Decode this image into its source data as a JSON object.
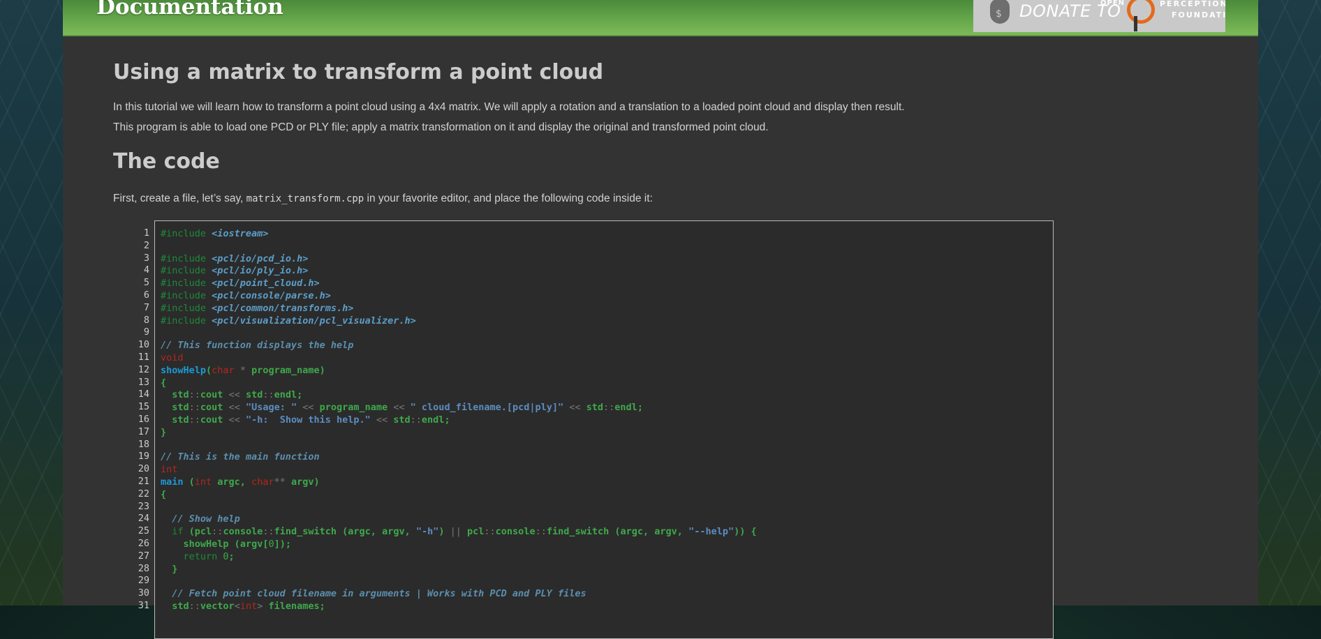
{
  "header": {
    "title": "Documentation",
    "donate": {
      "text": "DONATE TO",
      "open": "OPEN",
      "perception": "PERCEPTION",
      "foundation": "FOUNDATION"
    }
  },
  "article": {
    "title": "Using a matrix to transform a point cloud",
    "intro_1": "In this tutorial we will learn how to transform a point cloud using a 4x4 matrix. We will apply a rotation and a translation to a loaded point cloud and display then result.",
    "intro_2": "This program is able to load one PCD or PLY file; apply a matrix transformation on it and display the original and transformed point cloud.",
    "section_title": "The code",
    "section_text_before": "First, create a file, let’s say, ",
    "section_file": "matrix_transform.cpp",
    "section_text_after": " in your favorite editor, and place the following code inside it:"
  },
  "code": {
    "line_numbers": [
      "1",
      "2",
      "3",
      "4",
      "5",
      "6",
      "7",
      "8",
      "9",
      "10",
      "11",
      "12",
      "13",
      "14",
      "15",
      "16",
      "17",
      "18",
      "19",
      "20",
      "21",
      "22",
      "23",
      "24",
      "25",
      "26",
      "27",
      "28",
      "29",
      "30",
      "31"
    ],
    "lines": [
      [
        [
          "pre",
          "#include "
        ],
        [
          "inc",
          "<iostream>"
        ]
      ],
      [],
      [
        [
          "pre",
          "#include "
        ],
        [
          "inc",
          "<pcl/io/pcd_io.h>"
        ]
      ],
      [
        [
          "pre",
          "#include "
        ],
        [
          "inc",
          "<pcl/io/ply_io.h>"
        ]
      ],
      [
        [
          "pre",
          "#include "
        ],
        [
          "inc",
          "<pcl/point_cloud.h>"
        ]
      ],
      [
        [
          "pre",
          "#include "
        ],
        [
          "inc",
          "<pcl/console/parse.h>"
        ]
      ],
      [
        [
          "pre",
          "#include "
        ],
        [
          "inc",
          "<pcl/common/transforms.h>"
        ]
      ],
      [
        [
          "pre",
          "#include "
        ],
        [
          "inc",
          "<pcl/visualization/pcl_visualizer.h>"
        ]
      ],
      [],
      [
        [
          "com",
          "// This function displays the help"
        ]
      ],
      [
        [
          "kw",
          "void"
        ]
      ],
      [
        [
          "fn",
          "showHelp"
        ],
        [
          "p",
          "("
        ],
        [
          "kw",
          "char"
        ],
        [
          "op",
          " * "
        ],
        [
          "id",
          "program_name"
        ],
        [
          "p",
          ")"
        ]
      ],
      [
        [
          "p",
          "{"
        ]
      ],
      [
        [
          "id",
          "  std"
        ],
        [
          "op",
          "::"
        ],
        [
          "id",
          "cout "
        ],
        [
          "op",
          "<< "
        ],
        [
          "id",
          "std"
        ],
        [
          "op",
          "::"
        ],
        [
          "id",
          "endl"
        ],
        [
          "p",
          ";"
        ]
      ],
      [
        [
          "id",
          "  std"
        ],
        [
          "op",
          "::"
        ],
        [
          "id",
          "cout "
        ],
        [
          "op",
          "<< "
        ],
        [
          "str",
          "\"Usage: \""
        ],
        [
          "op",
          " << "
        ],
        [
          "id",
          "program_name "
        ],
        [
          "op",
          "<< "
        ],
        [
          "str",
          "\" cloud_filename.[pcd|ply]\""
        ],
        [
          "op",
          " << "
        ],
        [
          "id",
          "std"
        ],
        [
          "op",
          "::"
        ],
        [
          "id",
          "endl"
        ],
        [
          "p",
          ";"
        ]
      ],
      [
        [
          "id",
          "  std"
        ],
        [
          "op",
          "::"
        ],
        [
          "id",
          "cout "
        ],
        [
          "op",
          "<< "
        ],
        [
          "str",
          "\"-h:  Show this help.\""
        ],
        [
          "op",
          " << "
        ],
        [
          "id",
          "std"
        ],
        [
          "op",
          "::"
        ],
        [
          "id",
          "endl"
        ],
        [
          "p",
          ";"
        ]
      ],
      [
        [
          "p",
          "}"
        ]
      ],
      [],
      [
        [
          "com",
          "// This is the main function"
        ]
      ],
      [
        [
          "kw",
          "int"
        ]
      ],
      [
        [
          "fn",
          "main "
        ],
        [
          "p",
          "("
        ],
        [
          "kw",
          "int"
        ],
        [
          "id",
          " argc, "
        ],
        [
          "kw",
          "char"
        ],
        [
          "op",
          "** "
        ],
        [
          "id",
          "argv"
        ],
        [
          "p",
          ")"
        ]
      ],
      [
        [
          "p",
          "{"
        ]
      ],
      [],
      [
        [
          "com",
          "  // Show help"
        ]
      ],
      [
        [
          "kw2",
          "  if "
        ],
        [
          "p",
          "("
        ],
        [
          "id",
          "pcl"
        ],
        [
          "op",
          "::"
        ],
        [
          "id",
          "console"
        ],
        [
          "op",
          "::"
        ],
        [
          "id",
          "find_switch "
        ],
        [
          "p",
          "("
        ],
        [
          "id",
          "argc, argv, "
        ],
        [
          "str",
          "\"-h\""
        ],
        [
          "p",
          ") "
        ],
        [
          "op",
          "|| "
        ],
        [
          "id",
          "pcl"
        ],
        [
          "op",
          "::"
        ],
        [
          "id",
          "console"
        ],
        [
          "op",
          "::"
        ],
        [
          "id",
          "find_switch "
        ],
        [
          "p",
          "("
        ],
        [
          "id",
          "argc, argv, "
        ],
        [
          "str",
          "\"--help\""
        ],
        [
          "p",
          ")) {"
        ]
      ],
      [
        [
          "id",
          "    showHelp "
        ],
        [
          "p",
          "("
        ],
        [
          "id",
          "argv"
        ],
        [
          "p",
          "["
        ],
        [
          "num",
          "0"
        ],
        [
          "p",
          "]);"
        ]
      ],
      [
        [
          "kw2",
          "    return "
        ],
        [
          "num",
          "0"
        ],
        [
          "p",
          ";"
        ]
      ],
      [
        [
          "p",
          "  }"
        ]
      ],
      [],
      [
        [
          "com",
          "  // Fetch point cloud filename in arguments | Works with PCD and PLY files"
        ]
      ],
      [
        [
          "id",
          "  std"
        ],
        [
          "op",
          "::"
        ],
        [
          "id",
          "vector"
        ],
        [
          "op",
          "<"
        ],
        [
          "kw",
          "int"
        ],
        [
          "op",
          "> "
        ],
        [
          "id",
          "filenames"
        ],
        [
          "p",
          ";"
        ]
      ]
    ]
  }
}
